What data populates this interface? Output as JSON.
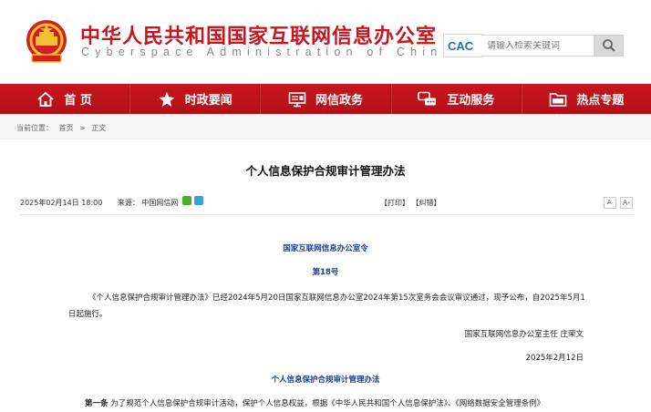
{
  "header": {
    "title_cn": "中华人民共和国国家互联网信息办公室",
    "title_en": "Cyberspace Administration of China",
    "cac_logo_text": "CAC",
    "search_placeholder": "请输入检索关键词",
    "emblem_icon": "national-emblem-icon",
    "search_icon": "search-icon"
  },
  "nav": [
    {
      "label": "首 页",
      "icon": "home-icon"
    },
    {
      "label": "时政要闻",
      "icon": "star-icon"
    },
    {
      "label": "网信政务",
      "icon": "monitor-icon"
    },
    {
      "label": "互动服务",
      "icon": "interaction-icon"
    },
    {
      "label": "热点专题",
      "icon": "folder-icon"
    }
  ],
  "breadcrumb": {
    "prefix": "当前位置：",
    "home": "首页",
    "sep": ">",
    "current": "正文"
  },
  "article": {
    "title": "个人信息保护合规审计管理办法",
    "date": "2025年02月14日  18:00",
    "source_label": "来源：",
    "source": "中国网信网",
    "print": "【打印】",
    "correct": "【纠错】",
    "font_small": "A",
    "font_large": "A",
    "decree": "国家互联网信息办公室令",
    "order_no": "第18号",
    "paragraph": "《个人信息保护合规审计管理办法》已经2024年5月20日国家互联网信息办公室2024年第15次室务会会议审议通过，现予公布，自2025年5月1日起施行。",
    "signer": "国家互联网信息办公室主任 庄荣文",
    "sign_date": "2025年2月12日",
    "subtitle": "个人信息保护合规审计管理办法",
    "article1_label": "第一条",
    "article1_text": " 为了规范个人信息保护合规审计活动，保护个人信息权益，根据《中华人民共和国个人信息保护法》、《网络数据安全管理条例》"
  },
  "colors": {
    "brand_red": "#c8161e",
    "heading_blue": "#1a3c8c"
  }
}
